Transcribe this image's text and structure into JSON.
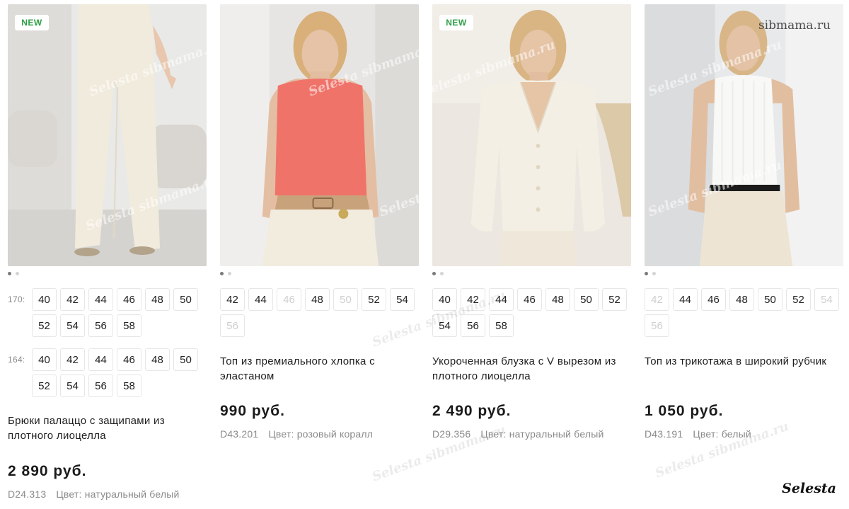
{
  "products": [
    {
      "badge": "NEW",
      "title": "Брюки палаццо с защипами из плотного лиоцелла",
      "price": "2 890 руб.",
      "sku": "D24.313",
      "color": "Цвет: натуральный белый",
      "size_groups": [
        {
          "height": "170:",
          "sizes": [
            {
              "v": "40",
              "on": true
            },
            {
              "v": "42",
              "on": true
            },
            {
              "v": "44",
              "on": true
            },
            {
              "v": "46",
              "on": true
            },
            {
              "v": "48",
              "on": true
            },
            {
              "v": "50",
              "on": true
            },
            {
              "v": "52",
              "on": true
            },
            {
              "v": "54",
              "on": true
            },
            {
              "v": "56",
              "on": true
            },
            {
              "v": "58",
              "on": true
            }
          ]
        },
        {
          "height": "164:",
          "sizes": [
            {
              "v": "40",
              "on": true
            },
            {
              "v": "42",
              "on": true
            },
            {
              "v": "44",
              "on": true
            },
            {
              "v": "46",
              "on": true
            },
            {
              "v": "48",
              "on": true
            },
            {
              "v": "50",
              "on": true
            },
            {
              "v": "52",
              "on": true
            },
            {
              "v": "54",
              "on": true
            },
            {
              "v": "56",
              "on": true
            },
            {
              "v": "58",
              "on": true
            }
          ]
        }
      ]
    },
    {
      "badge": "",
      "title": "Топ из премиального хлопка с эластаном",
      "price": "990 руб.",
      "sku": "D43.201",
      "color": "Цвет: розовый коралл",
      "size_groups": [
        {
          "height": "",
          "sizes": [
            {
              "v": "42",
              "on": true
            },
            {
              "v": "44",
              "on": true
            },
            {
              "v": "46",
              "on": false
            },
            {
              "v": "48",
              "on": true
            },
            {
              "v": "50",
              "on": false
            },
            {
              "v": "52",
              "on": true
            },
            {
              "v": "54",
              "on": true
            },
            {
              "v": "56",
              "on": false
            }
          ]
        }
      ]
    },
    {
      "badge": "NEW",
      "title": "Укороченная блузка с V вырезом из плотного лиоцелла",
      "price": "2 490 руб.",
      "sku": "D29.356",
      "color": "Цвет: натуральный белый",
      "size_groups": [
        {
          "height": "",
          "sizes": [
            {
              "v": "40",
              "on": true
            },
            {
              "v": "42",
              "on": true
            },
            {
              "v": "44",
              "on": true
            },
            {
              "v": "46",
              "on": true
            },
            {
              "v": "48",
              "on": true
            },
            {
              "v": "50",
              "on": true
            },
            {
              "v": "52",
              "on": true
            },
            {
              "v": "54",
              "on": true
            },
            {
              "v": "56",
              "on": true
            },
            {
              "v": "58",
              "on": true
            }
          ]
        }
      ]
    },
    {
      "badge": "",
      "title": "Топ из трикотажа в широкий рубчик",
      "price": "1 050 руб.",
      "sku": "D43.191",
      "color": "Цвет: белый",
      "size_groups": [
        {
          "height": "",
          "sizes": [
            {
              "v": "42",
              "on": false
            },
            {
              "v": "44",
              "on": true
            },
            {
              "v": "46",
              "on": true
            },
            {
              "v": "48",
              "on": true
            },
            {
              "v": "50",
              "on": true
            },
            {
              "v": "52",
              "on": true
            },
            {
              "v": "54",
              "on": false
            },
            {
              "v": "56",
              "on": false
            }
          ]
        }
      ]
    }
  ],
  "watermarks": {
    "site": "sibmama.ru",
    "brand": "Selesta",
    "pattern": "Selesta sibmama.ru"
  },
  "colors": {
    "badge_green": "#2e9e46",
    "text_dark": "#1d1d1d",
    "text_muted": "#8a8a8a",
    "size_border": "#e6e6e6",
    "size_disabled": "#cfcfcf",
    "coral_top": "#f0736a",
    "cream": "#f2ece0"
  }
}
